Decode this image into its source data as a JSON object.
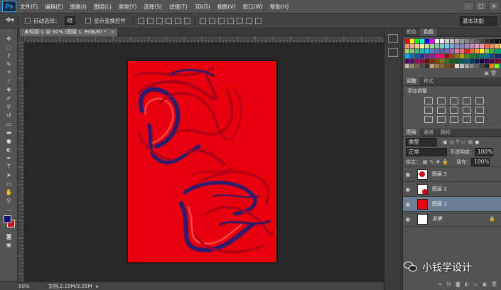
{
  "app": {
    "logo": "Ps"
  },
  "menu": [
    "文件(F)",
    "编辑(E)",
    "图像(I)",
    "图层(L)",
    "类型(Y)",
    "选择(S)",
    "滤镜(T)",
    "3D(D)",
    "视图(V)",
    "窗口(W)",
    "帮助(H)"
  ],
  "window_buttons": [
    "–",
    "□",
    "×"
  ],
  "options": {
    "auto_select_label": "自动选择：",
    "auto_select_value": "组",
    "show_transform_label": "显示变换控件",
    "workspace": "基本功能"
  },
  "document": {
    "tab_title": "未标题-1 @ 50% (图层 1, RGB/8) *",
    "close": "×"
  },
  "status": {
    "zoom": "50%",
    "doc_info": "文档:2.15M/3.05M"
  },
  "panels": {
    "color_tabs": [
      "颜色",
      "色板"
    ],
    "adjust_tabs": [
      "调整",
      "样式"
    ],
    "adjust_title": "添加调整",
    "layers_tabs": [
      "图层",
      "通道",
      "路径"
    ],
    "filter_kind": "类型",
    "blend_mode": "正常",
    "opacity_label": "不透明度：",
    "opacity_value": "100%",
    "lock_label": "锁定：",
    "fill_label": "填充：",
    "fill_value": "100%",
    "layers": [
      {
        "name": "图层 3",
        "thumb": "blob"
      },
      {
        "name": "图层 2",
        "thumb": "blob"
      },
      {
        "name": "图层 1",
        "thumb": "red",
        "selected": true
      },
      {
        "name": "背景",
        "thumb": "white",
        "locked": true
      }
    ]
  },
  "colors": {
    "foreground": "#0d1470",
    "background": "#e9000c",
    "canvas_red": "#e9000c",
    "swirl_blue": "#2a1b6e"
  },
  "watermark": {
    "text": "小钱学设计"
  }
}
